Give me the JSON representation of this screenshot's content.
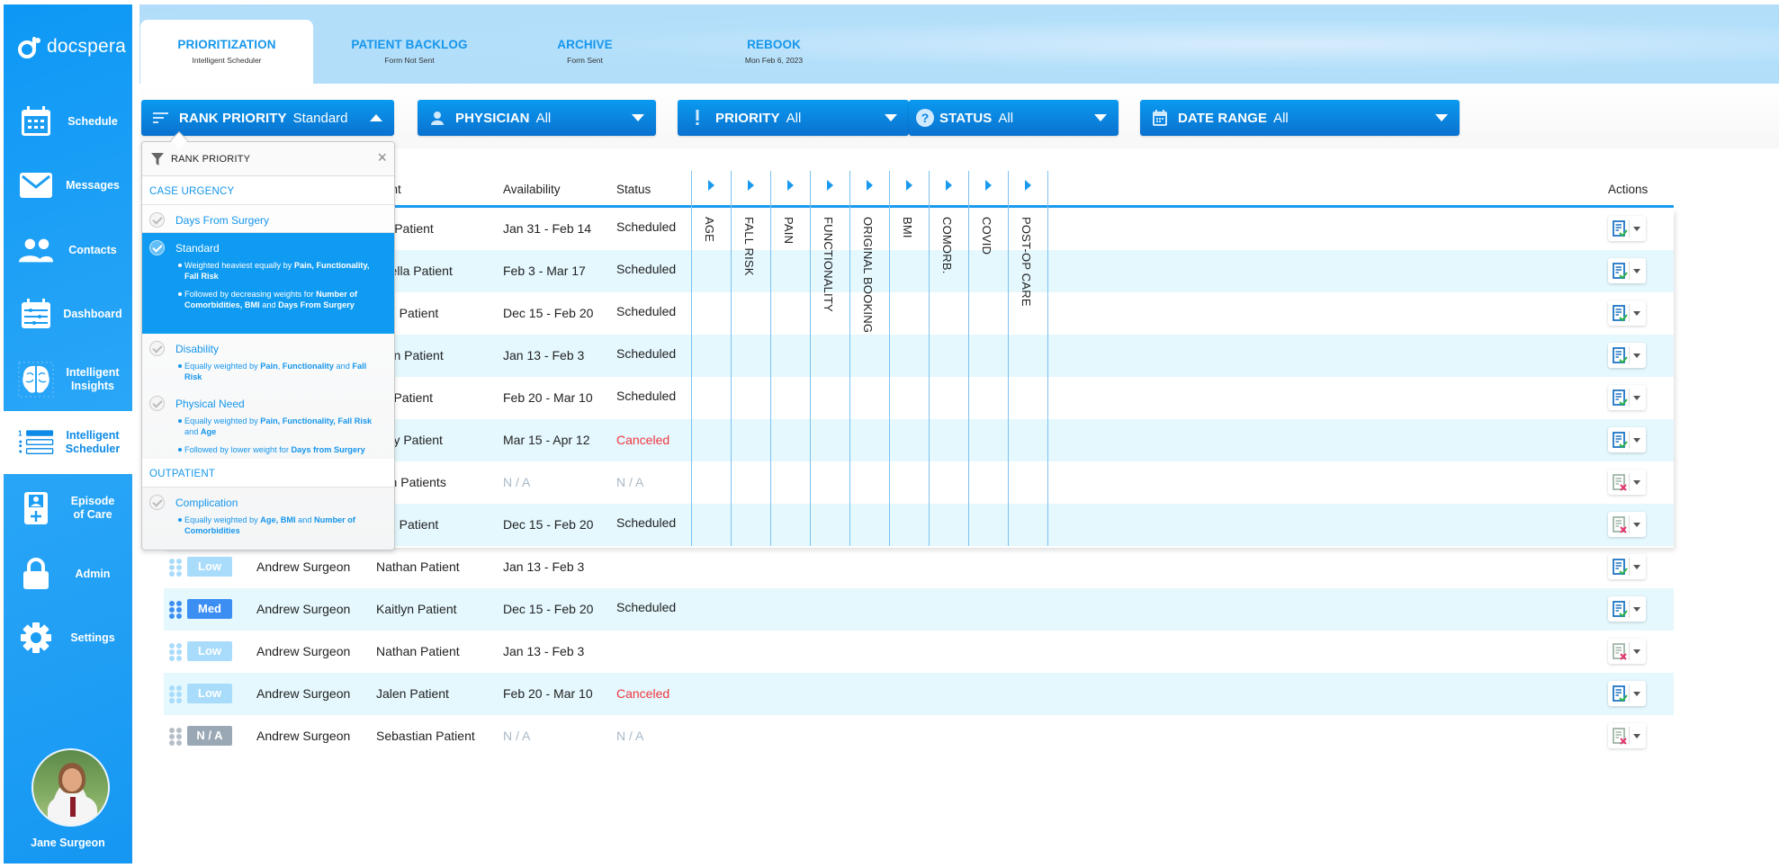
{
  "sidebar": {
    "logo_text": "docspera",
    "items": [
      {
        "label": "Schedule",
        "icon": "calendar-icon"
      },
      {
        "label": "Messages",
        "icon": "envelope-icon"
      },
      {
        "label": "Contacts",
        "icon": "people-icon"
      },
      {
        "label": "Dashboard",
        "icon": "dashboard-icon"
      },
      {
        "label": "Intelligent Insights",
        "icon": "brain-icon"
      },
      {
        "label": "Intelligent Scheduler",
        "icon": "ranked-list-icon",
        "active": true
      },
      {
        "label": "Episode of Care",
        "icon": "episode-icon"
      },
      {
        "label": "Admin",
        "icon": "lock-icon"
      },
      {
        "label": "Settings",
        "icon": "gear-icon"
      }
    ],
    "user_name": "Jane Surgeon"
  },
  "tabs": [
    {
      "title": "PRIORITIZATION",
      "subtitle": "Intelligent Scheduler",
      "active": true
    },
    {
      "title": "PATIENT BACKLOG",
      "subtitle": "Form Not Sent"
    },
    {
      "title": "ARCHIVE",
      "subtitle": "Form Sent"
    },
    {
      "title": "REBOOK",
      "subtitle": "Mon Feb 6, 2023"
    }
  ],
  "filters": {
    "rank": {
      "label": "RANK PRIORITY",
      "value": "Standard"
    },
    "physician": {
      "label": "PHYSICIAN",
      "value": "All"
    },
    "priority": {
      "label": "PRIORITY",
      "value": "All"
    },
    "status": {
      "label": "STATUS",
      "value": "All"
    },
    "date_range": {
      "label": "DATE RANGE",
      "value": "All"
    }
  },
  "dropdown": {
    "title": "RANK PRIORITY",
    "sections": [
      {
        "title": "CASE URGENCY",
        "options": [
          {
            "name": "Days From Surgery",
            "selected": false,
            "bullets": []
          },
          {
            "name": "Standard",
            "selected": true,
            "bullets": [
              "Weighted heaviest equally by <b>Pain, Functionality, Fall Risk</b>",
              "Followed by decreasing weights for <b>Number of Comorbidities, BMI</b> and <b>Days From Surgery</b>"
            ]
          },
          {
            "name": "Disability",
            "selected": false,
            "bullets": [
              "Equally weighted by <b>Pain</b>, <b>Functionality</b> and <b>Fall Risk</b>"
            ]
          },
          {
            "name": "Physical Need",
            "selected": false,
            "bullets": [
              "Equally weighted by <b>Pain, Functionality, Fall Risk</b> and <b>Age</b>",
              "Followed by lower weight for <b>Days from Surgery</b>"
            ]
          }
        ]
      },
      {
        "title": "OUTPATIENT",
        "options": [
          {
            "name": "Complication",
            "selected": false,
            "bullets": [
              "Equally weighted by <b>Age, BMI</b> and <b>Number of Comorbidities</b>"
            ]
          }
        ]
      }
    ]
  },
  "table": {
    "headers": {
      "patient_partial": "ient",
      "availability": "Availability",
      "status": "Status",
      "actions": "Actions"
    },
    "criteria": [
      "AGE",
      "FALL RISK",
      "PAIN",
      "FUNCTIONALITY",
      "ORIGINAL BOOKING",
      "BMI",
      "COMORB.",
      "COVID",
      "POST-OP CARE"
    ],
    "rows": [
      {
        "patient": "rry Patient",
        "availability": "Jan 31 - Feb 14",
        "status": "Scheduled",
        "form_sent": true
      },
      {
        "patient": "briella Patient",
        "availability": "Feb 3 - Mar 17",
        "status": "Scheduled",
        "form_sent": true
      },
      {
        "patient": "tlyn Patient",
        "availability": "Dec 15 - Feb 20",
        "status": "Scheduled",
        "form_sent": true
      },
      {
        "patient": "than Patient",
        "availability": "Jan 13 - Feb 3",
        "status": "Scheduled",
        "form_sent": true
      },
      {
        "patient": "en Patient",
        "availability": "Feb 20 - Mar 10",
        "status": "Scheduled",
        "form_sent": true
      },
      {
        "patient": "nmy Patient",
        "availability": "Mar 15 - Apr 12",
        "status": "Canceled",
        "form_sent": true
      },
      {
        "patient": "riah Patients",
        "availability": "N / A",
        "status": "N / A",
        "form_sent": false
      },
      {
        "patient": "tlyn Patient",
        "availability": "Dec 15 - Feb 20",
        "status": "Scheduled",
        "form_sent": false
      },
      {
        "priority": "Low",
        "physician": "Andrew Surgeon",
        "patient": "Nathan Patient",
        "availability": "Jan 13 - Feb 3",
        "status": "",
        "form_sent": true
      },
      {
        "priority": "Med",
        "physician": "Andrew Surgeon",
        "patient": "Kaitlyn Patient",
        "availability": "Dec 15 - Feb 20",
        "status": "Scheduled",
        "form_sent": true
      },
      {
        "priority": "Low",
        "physician": "Andrew Surgeon",
        "patient": "Nathan Patient",
        "availability": "Jan 13 - Feb 3",
        "status": "",
        "form_sent": false
      },
      {
        "priority": "Low",
        "physician": "Andrew Surgeon",
        "patient": "Jalen Patient",
        "availability": "Feb 20 - Mar 10",
        "status": "Canceled",
        "form_sent": true
      },
      {
        "priority": "N / A",
        "physician": "Andrew Surgeon",
        "patient": "Sebastian Patient",
        "availability": "N / A",
        "status": "N / A",
        "form_sent": false
      }
    ]
  },
  "colors": {
    "brand": "#0d98f5",
    "tab_text": "#1596ec",
    "canceled": "#f0363f",
    "na_text": "#a8b8c6",
    "priority_low": "#a9dcfb",
    "priority_med": "#3c8ef3",
    "priority_na": "#9aa8b5",
    "row_alt": "#e4f8fe"
  }
}
